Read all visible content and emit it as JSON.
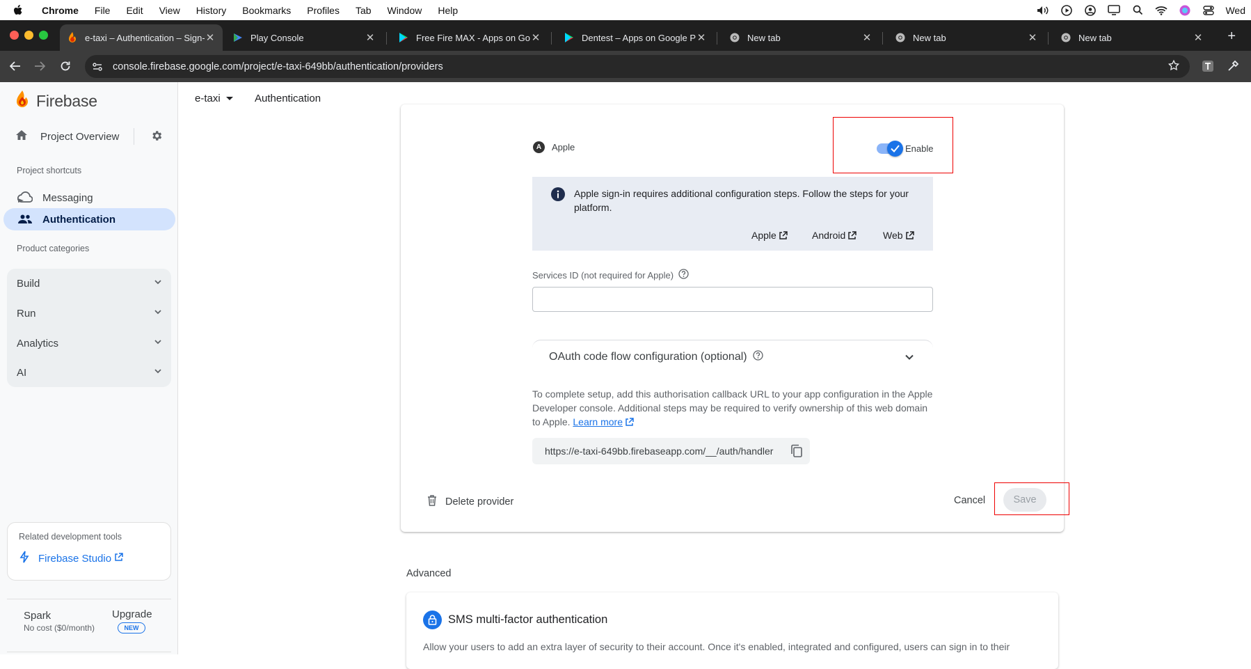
{
  "menubar": {
    "app": "Chrome",
    "items": [
      "File",
      "Edit",
      "View",
      "History",
      "Bookmarks",
      "Profiles",
      "Tab",
      "Window",
      "Help"
    ],
    "clock": "Wed"
  },
  "tabs": [
    {
      "title": "e-taxi – Authentication – Sign-in",
      "favicon": "firebase-icon",
      "active": true
    },
    {
      "title": "Play Console",
      "favicon": "play-console-icon"
    },
    {
      "title": "Free Fire MAX - Apps on Google Play",
      "favicon": "play-store-icon"
    },
    {
      "title": "Dentest – Apps on Google Play",
      "favicon": "play-store-icon"
    },
    {
      "title": "New tab",
      "favicon": "chrome-icon"
    },
    {
      "title": "New tab",
      "favicon": "chrome-icon"
    },
    {
      "title": "New tab",
      "favicon": "chrome-icon"
    }
  ],
  "toolbar": {
    "url": "console.firebase.google.com/project/e-taxi-649bb/authentication/providers"
  },
  "sidebar": {
    "brand": "Firebase",
    "project_overview": "Project Overview",
    "shortcuts_label": "Project shortcuts",
    "shortcuts": [
      {
        "label": "Messaging",
        "icon": "cloud-messaging-icon"
      },
      {
        "label": "Authentication",
        "icon": "people-icon",
        "selected": true
      }
    ],
    "categories_label": "Product categories",
    "categories": [
      "Build",
      "Run",
      "Analytics",
      "AI"
    ],
    "related_label": "Related development tools",
    "related_link": "Firebase Studio",
    "plan": "Spark",
    "plan_sub": "No cost ($0/month)",
    "upgrade": "Upgrade",
    "new_badge": "NEW"
  },
  "header": {
    "project": "e-taxi",
    "section": "Authentication"
  },
  "provider": {
    "name": "Apple",
    "enable_label": "Enable",
    "enabled": true,
    "info_text": "Apple sign-in requires additional configuration steps. Follow the steps for your platform.",
    "platform_links": [
      "Apple",
      "Android",
      "Web"
    ],
    "services_id_label": "Services ID (not required for Apple)",
    "services_id_value": "",
    "oauth_label": "OAuth code flow configuration (optional)",
    "setup_text": "To complete setup, add this authorisation callback URL to your app configuration in the Apple Developer console. Additional steps may be required to verify ownership of this web domain to Apple.",
    "learn_more": "Learn more",
    "callback_url": "https://e-taxi-649bb.firebaseapp.com/__/auth/handler",
    "delete_label": "Delete provider",
    "cancel_label": "Cancel",
    "save_label": "Save"
  },
  "advanced": {
    "label": "Advanced",
    "sms_title": "SMS multi-factor authentication",
    "sms_desc": "Allow your users to add an extra layer of security to their account. Once it's enabled, integrated and configured, users can sign in to their"
  },
  "colors": {
    "accent": "#1a73e8",
    "highlight": "#ee0000",
    "selected_nav": "#d3e3fd",
    "info_bg": "#e8ecf3"
  }
}
